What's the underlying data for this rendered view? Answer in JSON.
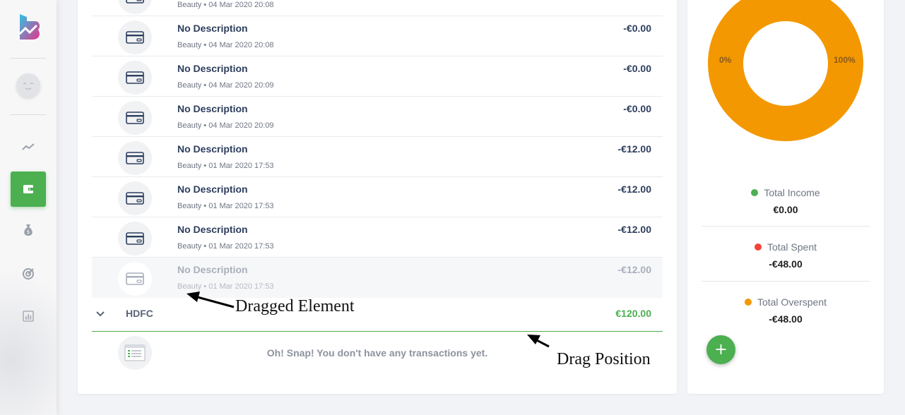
{
  "app": {
    "logo_name": "budget-app-logo"
  },
  "sidebar": {
    "items": [
      {
        "icon": "trend-line-icon"
      },
      {
        "icon": "wallet-icon",
        "active": true
      },
      {
        "icon": "money-bag-icon"
      },
      {
        "icon": "target-icon"
      },
      {
        "icon": "bar-chart-icon"
      }
    ]
  },
  "transactions": [
    {
      "title": "",
      "meta": "Beauty • 04 Mar 2020 20:08",
      "amount": ""
    },
    {
      "title": "No Description",
      "meta": "Beauty • 04 Mar 2020 20:08",
      "amount": "-€0.00"
    },
    {
      "title": "No Description",
      "meta": "Beauty • 04 Mar 2020 20:09",
      "amount": "-€0.00"
    },
    {
      "title": "No Description",
      "meta": "Beauty • 04 Mar 2020 20:09",
      "amount": "-€0.00"
    },
    {
      "title": "No Description",
      "meta": "Beauty • 01 Mar 2020 17:53",
      "amount": "-€12.00"
    },
    {
      "title": "No Description",
      "meta": "Beauty • 01 Mar 2020 17:53",
      "amount": "-€12.00"
    },
    {
      "title": "No Description",
      "meta": "Beauty • 01 Mar 2020 17:53",
      "amount": "-€12.00"
    },
    {
      "title": "No Description",
      "meta": "Beauty • 01 Mar 2020 17:53",
      "amount": "-€12.00"
    }
  ],
  "account": {
    "name": "HDFC",
    "amount": "€120.00"
  },
  "empty_state": {
    "text": "Oh! Snap! You don't have any transactions yet."
  },
  "annotations": {
    "dragged": "Dragged Element",
    "drag_position": "Drag Position"
  },
  "summary": {
    "donut": {
      "left_label": "0%",
      "right_label": "100%",
      "color": "#f39800"
    },
    "income": {
      "label": "Total Income",
      "value": "€0.00",
      "color": "#4caf50"
    },
    "spent": {
      "label": "Total Spent",
      "value": "-€48.00",
      "color": "#f44336"
    },
    "overspent": {
      "label": "Total Overspent",
      "value": "-€48.00",
      "color": "#f39800"
    },
    "add_label": "+"
  }
}
